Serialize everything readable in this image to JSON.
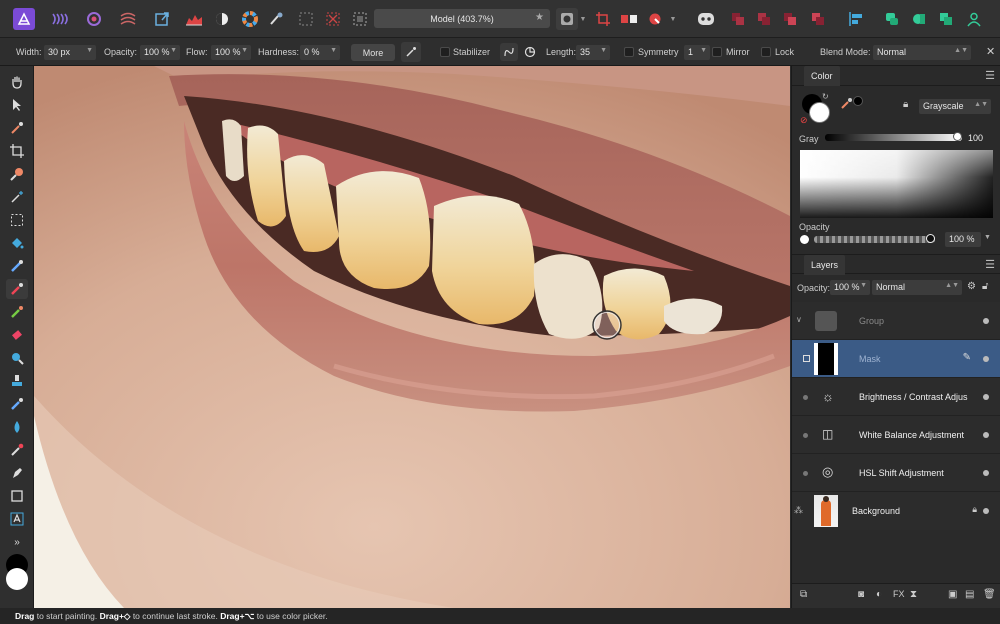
{
  "toolbar": {
    "document_title": "Model (403.7%)",
    "icons": [
      "photo-persona-icon",
      "liquify-persona-icon",
      "develop-persona-icon",
      "tone-mapping-persona-icon",
      "export-persona-icon",
      "histogram-icon",
      "adjustments-icon",
      "color-wheel-icon",
      "brush-icon",
      "selection-grid-icon",
      "no-selection-icon",
      "marquee-icon",
      "assistant-icon",
      "arrange-icons",
      "snapping-icon",
      "studio-icons"
    ]
  },
  "context": {
    "width_label": "Width:",
    "width_value": "30 px",
    "opacity_label": "Opacity:",
    "opacity_value": "100 %",
    "flow_label": "Flow:",
    "flow_value": "100 %",
    "hardness_label": "Hardness:",
    "hardness_value": "0 %",
    "more_label": "More",
    "stabilizer_label": "Stabilizer",
    "length_label": "Length:",
    "length_value": "35",
    "symmetry_label": "Symmetry",
    "symmetry_value": "1",
    "mirror_label": "Mirror",
    "lock_label": "Lock",
    "blend_label": "Blend Mode:",
    "blend_value": "Normal"
  },
  "color_panel": {
    "tab": "Color",
    "mode": "Grayscale",
    "gray_label": "Gray",
    "gray_value": "100",
    "gray_fraction": 1.0,
    "opacity_label": "Opacity",
    "opacity_value": "100 %",
    "opacity_fraction": 1.0
  },
  "layers_panel": {
    "tab": "Layers",
    "opacity_label": "Opacity:",
    "opacity_value": "100 %",
    "blend_value": "Normal",
    "layers": [
      {
        "name": "Group"
      },
      {
        "name": "Mask"
      },
      {
        "name": "Brightness / Contrast Adjus"
      },
      {
        "name": "White Balance Adjustment"
      },
      {
        "name": "HSL Shift Adjustment"
      },
      {
        "name": "Background"
      }
    ]
  },
  "status": {
    "drag1": "Drag",
    "text1": " to start painting. ",
    "drag2": "Drag+◇",
    "text2": " to continue last stroke. ",
    "drag3": "Drag+⌥",
    "text3": " to use color picker."
  },
  "colors": {
    "accent": "#3b5b86",
    "persona": "#7b4bd6"
  }
}
